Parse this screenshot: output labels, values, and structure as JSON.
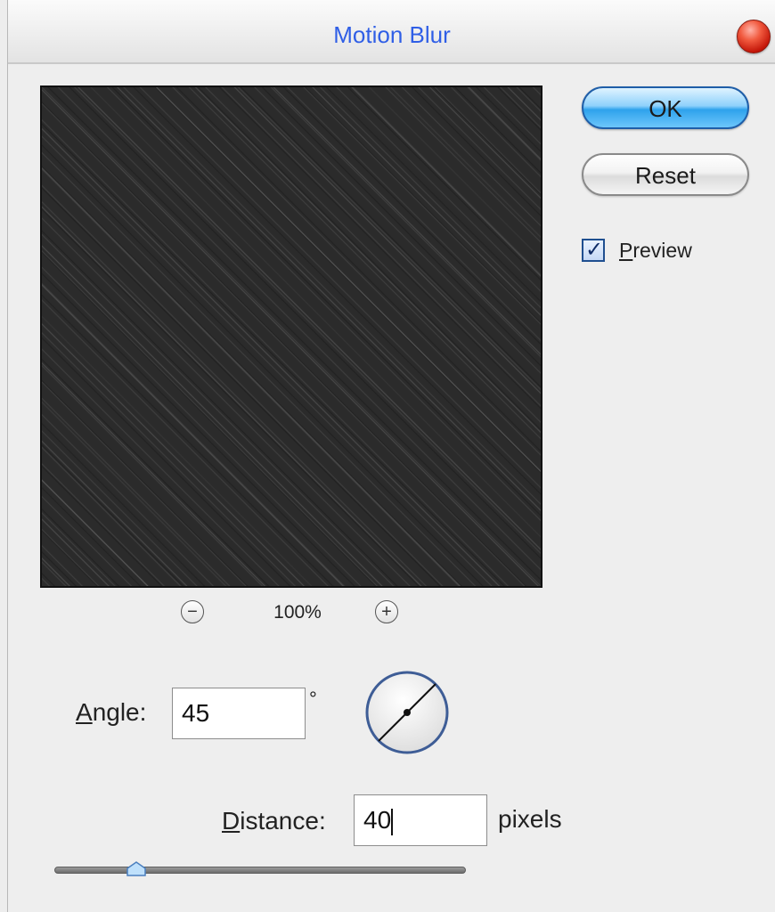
{
  "dialog": {
    "title": "Motion Blur",
    "ok_label": "OK",
    "reset_label": "Reset",
    "preview_label": "Preview",
    "preview_checked": true
  },
  "zoom": {
    "minus_label": "−",
    "plus_label": "+",
    "level": "100%"
  },
  "angle": {
    "label": "Angle:",
    "value": "45",
    "unit": "°"
  },
  "distance": {
    "label": "Distance:",
    "value": "40",
    "unit": "pixels",
    "slider_fraction": 0.2
  },
  "colors": {
    "title": "#2f5ee6",
    "ok_button": "#2ea2ec",
    "close_button": "#c21407"
  }
}
